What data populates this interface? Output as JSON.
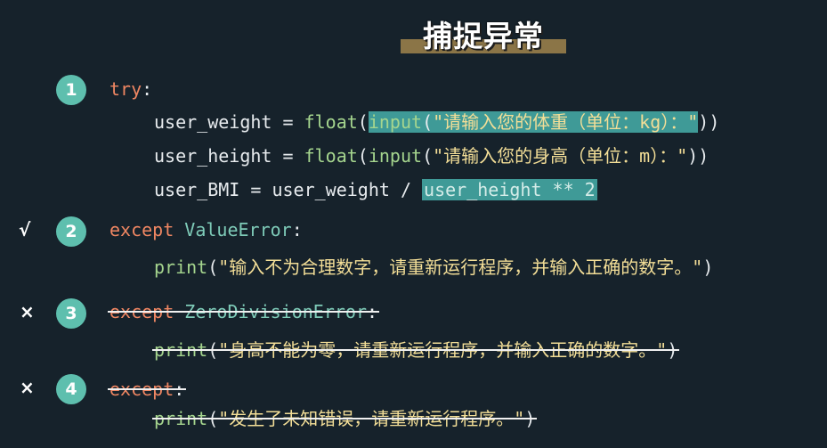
{
  "title": "捕捉异常",
  "blocks": [
    {
      "num": "1",
      "mark": ""
    },
    {
      "num": "2",
      "mark": "√"
    },
    {
      "num": "3",
      "mark": "×"
    },
    {
      "num": "4",
      "mark": "×"
    }
  ],
  "code": {
    "try_kw": "try",
    "colon": ":",
    "w_var": "user_weight = ",
    "float1": "float",
    "paren_open": "(",
    "input1": "input",
    "str_w": "\"请输入您的体重（单位：kg）：\"",
    "paren_close2": "))",
    "h_var": "user_height = ",
    "float2": "float",
    "input2": "input",
    "str_h": "\"请输入您的身高（单位：m）：\"",
    "bmi_prefix": "user_BMI = user_weight / ",
    "bmi_hl": "user_height ** 2",
    "except1": "except",
    "value_error": " ValueError",
    "print1": "print",
    "str_p1": "\"输入不为合理数字，请重新运行程序，并输入正确的数字。\"",
    "paren_close1": ")",
    "except2": "except",
    "zero_error": " ZeroDivisionError",
    "print2": "print",
    "str_p2": "\"身高不能为零，请重新运行程序，并输入正确的数字。\"",
    "except3": "except",
    "print3": "print",
    "str_p3": "\"发生了未知错误，请重新运行程序。\""
  }
}
